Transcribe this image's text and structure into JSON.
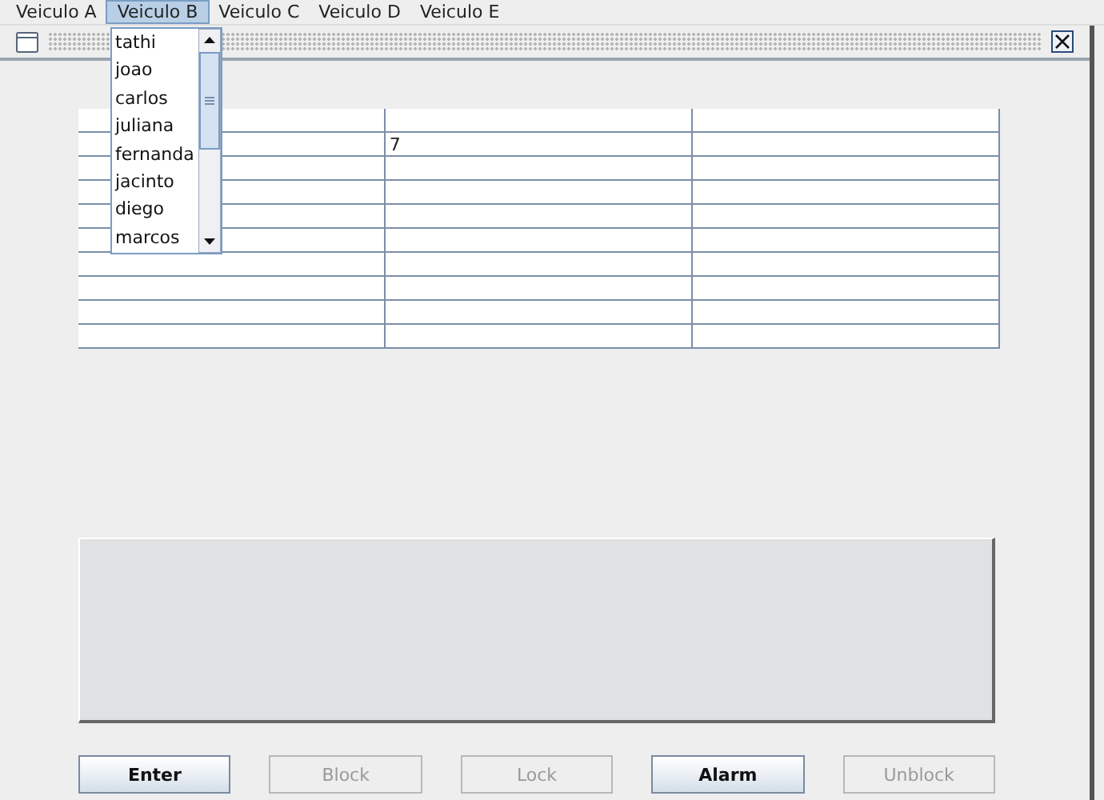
{
  "menu": [
    {
      "label": "Veiculo A",
      "selected": false
    },
    {
      "label": "Veiculo B",
      "selected": true
    },
    {
      "label": "Veiculo C",
      "selected": false
    },
    {
      "label": "Veiculo D",
      "selected": false
    },
    {
      "label": "Veiculo E",
      "selected": false
    }
  ],
  "dropdown": {
    "items": [
      "tathi",
      "joao",
      "carlos",
      "juliana",
      "fernanda",
      "jacinto",
      "diego",
      "marcos"
    ]
  },
  "table": {
    "rows": [
      {},
      {
        "column_2": "7"
      },
      {},
      {},
      {},
      {},
      {},
      {},
      {},
      {}
    ]
  },
  "buttons": [
    {
      "label": "Enter",
      "disabled": false
    },
    {
      "label": "Block",
      "disabled": true
    },
    {
      "label": "Lock",
      "disabled": true
    },
    {
      "label": "Alarm",
      "disabled": false
    },
    {
      "label": "Unblock",
      "disabled": true
    }
  ]
}
